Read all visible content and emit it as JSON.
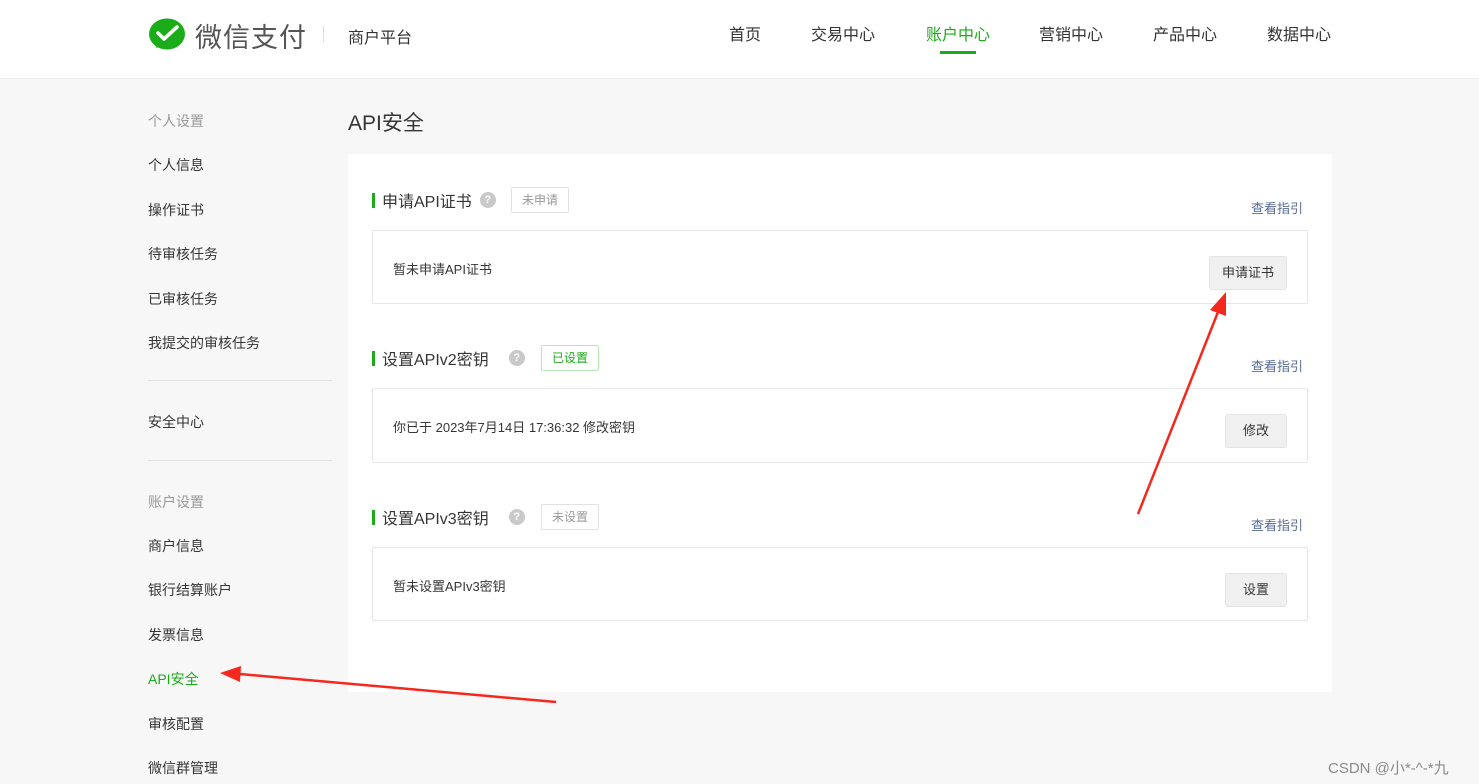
{
  "header": {
    "brand": "微信支付",
    "platform": "商户平台",
    "nav": [
      {
        "label": "首页"
      },
      {
        "label": "交易中心"
      },
      {
        "label": "账户中心"
      },
      {
        "label": "营销中心"
      },
      {
        "label": "产品中心"
      },
      {
        "label": "数据中心"
      }
    ],
    "active_nav": "账户中心"
  },
  "sidebar": {
    "group1": "个人设置",
    "group1_items": [
      "个人信息",
      "操作证书",
      "待审核任务",
      "已审核任务",
      "我提交的审核任务"
    ],
    "security_center": "安全中心",
    "group2": "账户设置",
    "group2_items": [
      "商户信息",
      "银行结算账户",
      "发票信息",
      "API安全",
      "审核配置",
      "微信群管理"
    ],
    "active_item": "API安全"
  },
  "main": {
    "title": "API安全",
    "sections": [
      {
        "title": "申请API证书",
        "status": "未申请",
        "guide": "查看指引",
        "text": "暂未申请API证书",
        "button": "申请证书"
      },
      {
        "title": "设置APIv2密钥",
        "status": "已设置",
        "guide": "查看指引",
        "text": "你已于 2023年7月14日 17:36:32 修改密钥",
        "button": "修改"
      },
      {
        "title": "设置APIv3密钥",
        "status": "未设置",
        "guide": "查看指引",
        "text": "暂未设置APIv3密钥",
        "button": "设置"
      }
    ]
  },
  "colors": {
    "accent": "#1aad19",
    "link": "#576b95",
    "annotation_arrow": "#f5281e"
  },
  "watermark": "CSDN @小*-^-*九"
}
